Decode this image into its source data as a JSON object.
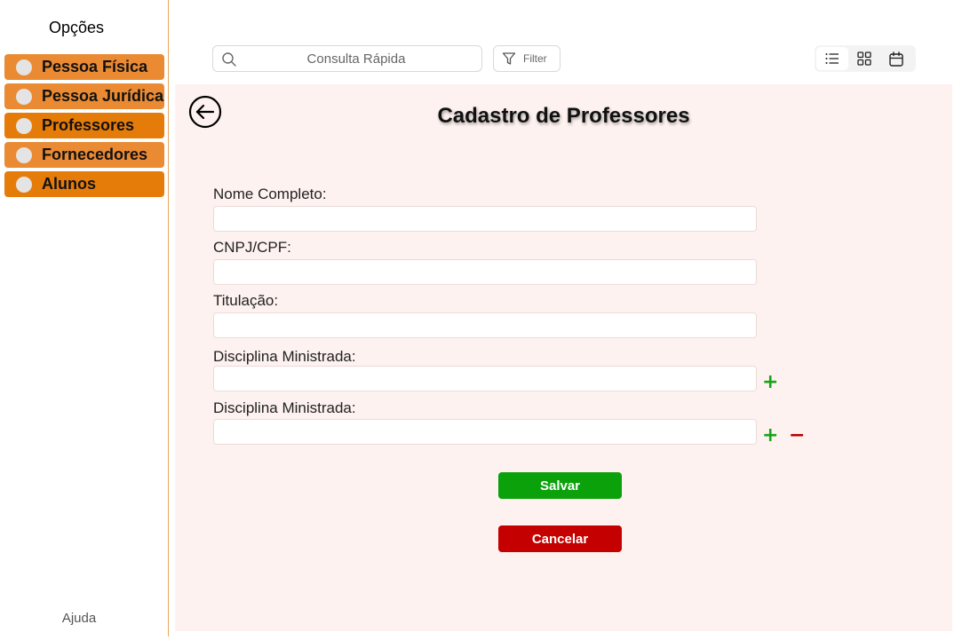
{
  "sidebar": {
    "title": "Opções",
    "items": [
      {
        "label": "Pessoa Física",
        "color": "#ea8a33"
      },
      {
        "label": "Pessoa Jurídica",
        "color": "#ea8a33"
      },
      {
        "label": "Professores",
        "color": "#e57c0a"
      },
      {
        "label": "Fornecedores",
        "color": "#ea8a33"
      },
      {
        "label": "Alunos",
        "color": "#e57c0a"
      }
    ],
    "help": "Ajuda"
  },
  "toolbar": {
    "search_placeholder": "Consulta Rápida",
    "filter_label": "Filter",
    "views": [
      "list-view",
      "grid-view",
      "calendar-view"
    ],
    "active_view": "list-view"
  },
  "form": {
    "title": "Cadastro de Professores",
    "fields": [
      {
        "label": "Nome Completo:",
        "value": ""
      },
      {
        "label": "CNPJ/CPF:",
        "value": ""
      },
      {
        "label": "Titulação:",
        "value": ""
      },
      {
        "label": "Disciplina Ministrada:",
        "value": ""
      },
      {
        "label": "Disciplina Ministrada:",
        "value": ""
      }
    ],
    "add_symbol": "+",
    "remove_symbol": "−",
    "save_label": "Salvar",
    "cancel_label": "Cancelar"
  },
  "colors": {
    "accent": "#ea8a33",
    "panel_background": "#fdf2ef",
    "save": "#0aa10a",
    "cancel": "#c40000",
    "add": "#19a319",
    "remove": "#b30000"
  }
}
